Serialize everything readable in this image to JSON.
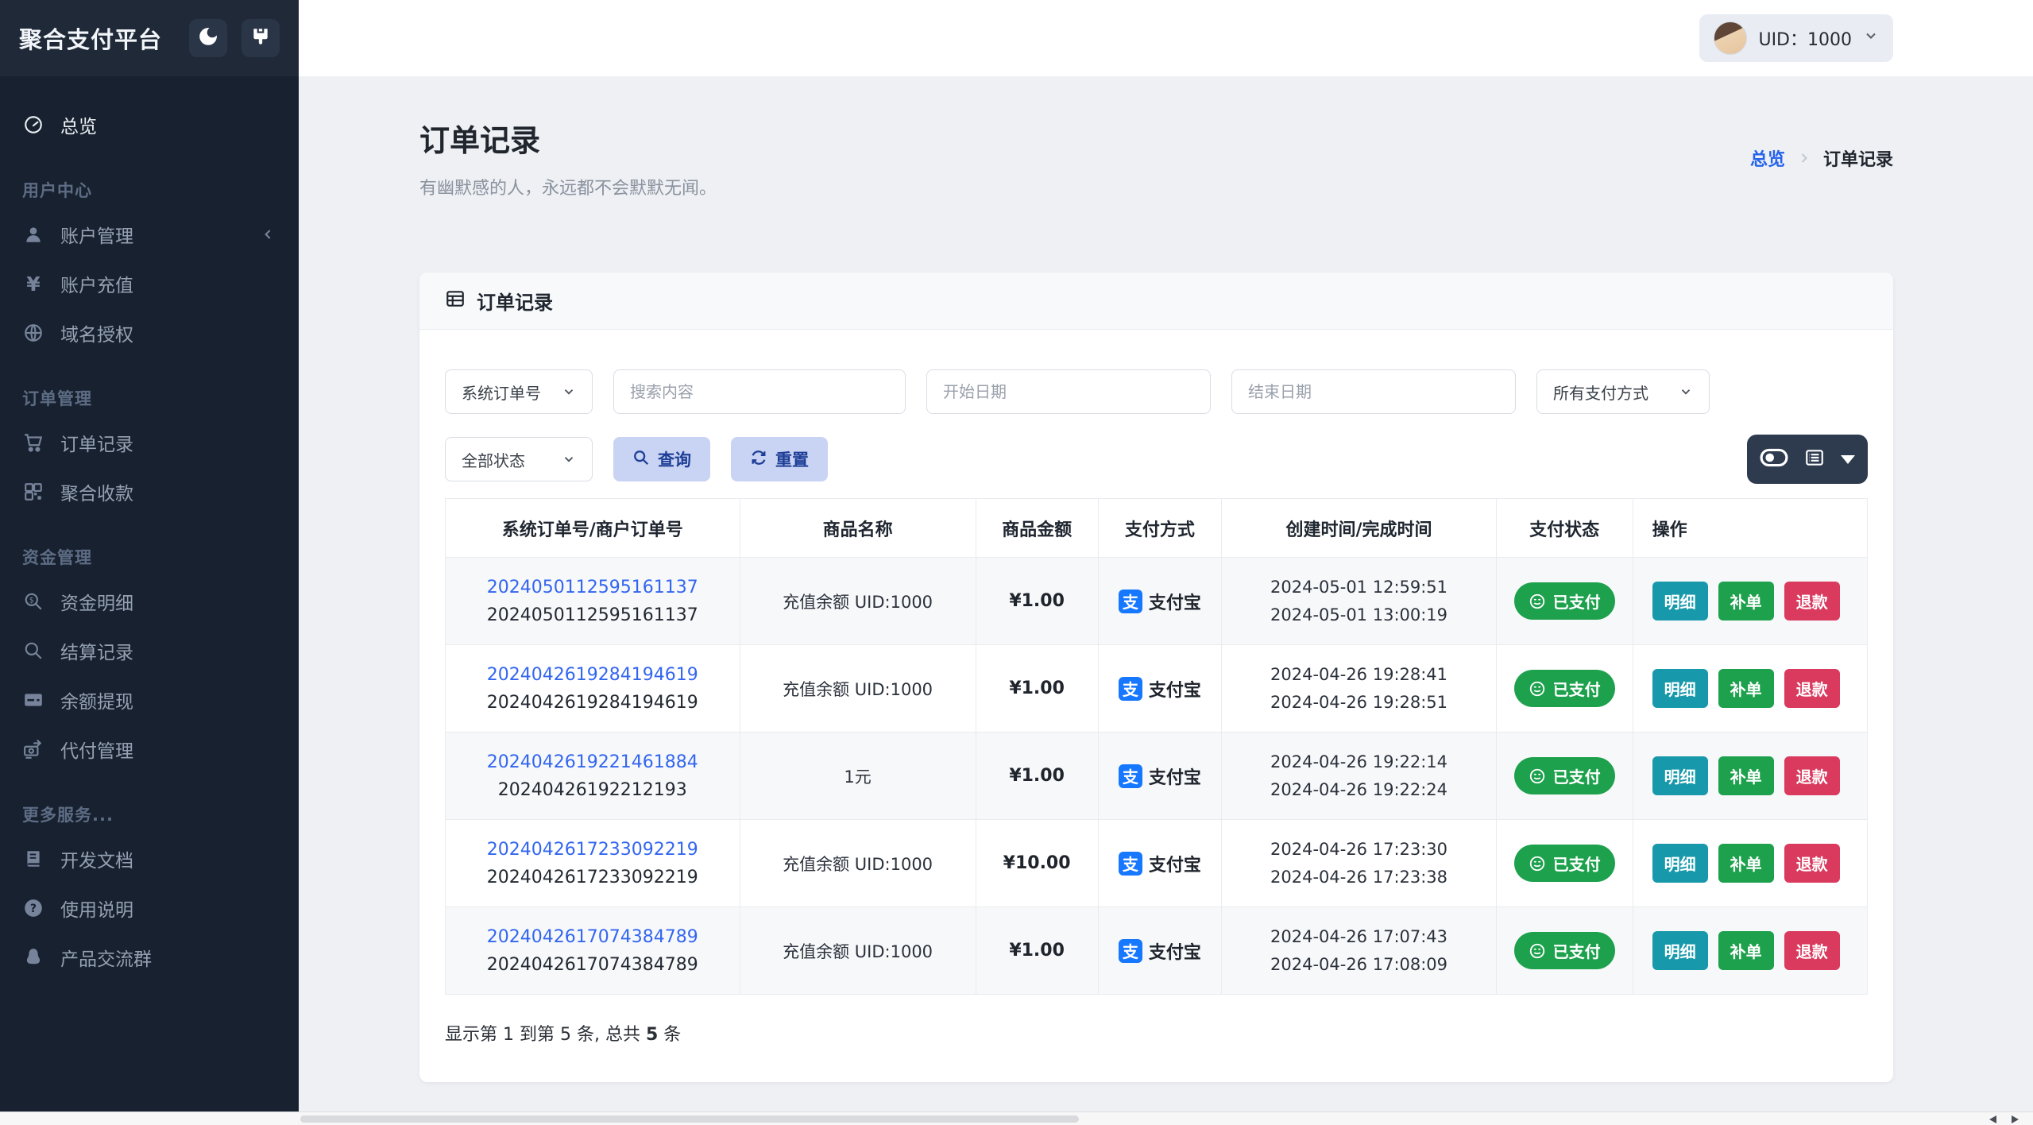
{
  "app": {
    "title": "聚合支付平台"
  },
  "topbar": {
    "uid": "UID：1000"
  },
  "sidebar": {
    "overview": "总览",
    "sections": [
      {
        "label": "用户中心",
        "items": [
          {
            "label": "账户管理"
          },
          {
            "label": "账户充值"
          },
          {
            "label": "域名授权"
          }
        ]
      },
      {
        "label": "订单管理",
        "items": [
          {
            "label": "订单记录"
          },
          {
            "label": "聚合收款"
          }
        ]
      },
      {
        "label": "资金管理",
        "items": [
          {
            "label": "资金明细"
          },
          {
            "label": "结算记录"
          },
          {
            "label": "余额提现"
          },
          {
            "label": "代付管理"
          }
        ]
      },
      {
        "label": "更多服务...",
        "items": [
          {
            "label": "开发文档"
          },
          {
            "label": "使用说明"
          },
          {
            "label": "产品交流群"
          }
        ]
      }
    ]
  },
  "page": {
    "title": "订单记录",
    "subtitle": "有幽默感的人，永远都不会默默无闻。",
    "breadcrumb": {
      "home": "总览",
      "current": "订单记录"
    }
  },
  "card": {
    "header": "订单记录"
  },
  "filters": {
    "order_type": "系统订单号",
    "search_placeholder": "搜索内容",
    "start_date_placeholder": "开始日期",
    "end_date_placeholder": "结束日期",
    "pay_method": "所有支付方式",
    "status": "全部状态",
    "query": "查询",
    "reset": "重置"
  },
  "table": {
    "columns": [
      "系统订单号/商户订单号",
      "商品名称",
      "商品金额",
      "支付方式",
      "创建时间/完成时间",
      "支付状态",
      "操作"
    ],
    "alipay_glyph": "支",
    "actions": {
      "detail": "明细",
      "reissue": "补单",
      "refund": "退款"
    },
    "rows": [
      {
        "sys_no": "2024050112595161137",
        "merchant_no": "2024050112595161137",
        "product": "充值余额 UID:1000",
        "amount": "¥1.00",
        "method": "支付宝",
        "created": "2024-05-01 12:59:51",
        "completed": "2024-05-01 13:00:19",
        "status": "已支付"
      },
      {
        "sys_no": "2024042619284194619",
        "merchant_no": "2024042619284194619",
        "product": "充值余额 UID:1000",
        "amount": "¥1.00",
        "method": "支付宝",
        "created": "2024-04-26 19:28:41",
        "completed": "2024-04-26 19:28:51",
        "status": "已支付"
      },
      {
        "sys_no": "2024042619221461884",
        "merchant_no": "20240426192212193",
        "product": "1元",
        "amount": "¥1.00",
        "method": "支付宝",
        "created": "2024-04-26 19:22:14",
        "completed": "2024-04-26 19:22:24",
        "status": "已支付"
      },
      {
        "sys_no": "2024042617233092219",
        "merchant_no": "2024042617233092219",
        "product": "充值余额 UID:1000",
        "amount": "¥10.00",
        "method": "支付宝",
        "created": "2024-04-26 17:23:30",
        "completed": "2024-04-26 17:23:38",
        "status": "已支付"
      },
      {
        "sys_no": "2024042617074384789",
        "merchant_no": "2024042617074384789",
        "product": "充值余额 UID:1000",
        "amount": "¥1.00",
        "method": "支付宝",
        "created": "2024-04-26 17:07:43",
        "completed": "2024-04-26 17:08:09",
        "status": "已支付"
      }
    ],
    "footer_prefix": "显示第 1 到第 5 条, 总共 ",
    "footer_total": "5",
    "footer_suffix": " 条"
  },
  "colors": {
    "sidebar-bg": "#17212f",
    "sidebar-header-bg": "#1f2937",
    "accent-blue": "#2563eb",
    "link-blue": "#3366f0",
    "btn-bg": "#c9d3f3",
    "btn-text": "#1e3f97",
    "green": "#1da14d",
    "teal": "#1899ab",
    "red": "#d93a5e",
    "alipay": "#1677ff",
    "darkbtn": "#2e3b4f"
  }
}
